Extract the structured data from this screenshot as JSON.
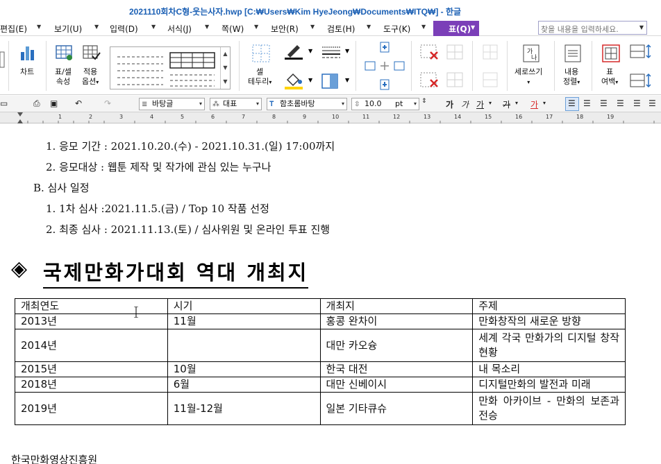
{
  "window": {
    "title": "2021110회차C형-웃는사자.hwp [C:₩Users₩Kim HyeJeong₩Documents₩ITQ₩] - 한글"
  },
  "menu": {
    "items": [
      {
        "label": "편집(E)"
      },
      {
        "label": "보기(U)"
      },
      {
        "label": "입력(D)"
      },
      {
        "label": "서식(J)"
      },
      {
        "label": "쪽(W)"
      },
      {
        "label": "보안(R)"
      },
      {
        "label": "검토(H)"
      },
      {
        "label": "도구(K)"
      }
    ],
    "active_tab": "표(Q)",
    "search_placeholder": "찾을 내용을 입력하세요."
  },
  "ribbon": {
    "chart_label": "차트",
    "table_props_label": "표/셀\n속성",
    "apply_options_label": "적용\n옵션",
    "cell_border_label": "셀\n테두리",
    "vertical_write_label": "세로쓰기",
    "content_align_label": "내용\n정렬",
    "table_margin_label": "표\n여백"
  },
  "format_bar": {
    "style_value": "바탕글",
    "lang_value": "대표",
    "font_value": "함초롬바탕",
    "size_value": "10.0",
    "size_unit": "pt",
    "bold_glyph": "가",
    "italic_glyph": "가",
    "underline_glyph": "가",
    "strike_glyph": "가",
    "color_glyph": "가"
  },
  "ruler": {
    "numbers": [
      "1",
      "2",
      "3",
      "4",
      "5",
      "6",
      "7",
      "8",
      "9",
      "10",
      "11",
      "12",
      "13",
      "14",
      "15",
      "16",
      "17",
      "18",
      "19"
    ]
  },
  "document": {
    "lines": [
      "1. 응모 기간 : 2021.10.20.(수) - 2021.10.31.(일) 17:00까지",
      "2. 응모대상 : 웹툰 제작 및 작가에 관심 있는 누구나",
      "B. 심사 일정",
      "1. 1차 심사 :2021.11.5.(금) / Top 10 작품 선정",
      "2. 최종 심사 : 2021.11.13.(토) / 심사위원 및 온라인 투표 진행"
    ],
    "heading_symbol": "◈",
    "heading": "국제만화가대회 역대 개최지",
    "table": {
      "headers": [
        "개최연도",
        "시기",
        "개최지",
        "주제"
      ],
      "rows": [
        [
          "2013년",
          "11월",
          "홍콩 완차이",
          "만화창작의 새로운 방향"
        ],
        [
          "2014년",
          "",
          "대만 카오슝",
          "세계 각국 만화가의 디지털 창작 현황"
        ],
        [
          "2015년",
          "10월",
          "한국 대전",
          "내 목소리"
        ],
        [
          "2018년",
          "6월",
          "대만 신베이시",
          "디지털만화의 발전과 미래"
        ],
        [
          "2019년",
          "11월-12월",
          "일본 기타큐슈",
          "만화 아카이브 - 만화의 보존과 전승"
        ]
      ]
    },
    "footer": "한국만화영상진흥원"
  },
  "colors": {
    "active_tab_bg": "#7b3fb8",
    "title_text": "#1a5fb4"
  }
}
